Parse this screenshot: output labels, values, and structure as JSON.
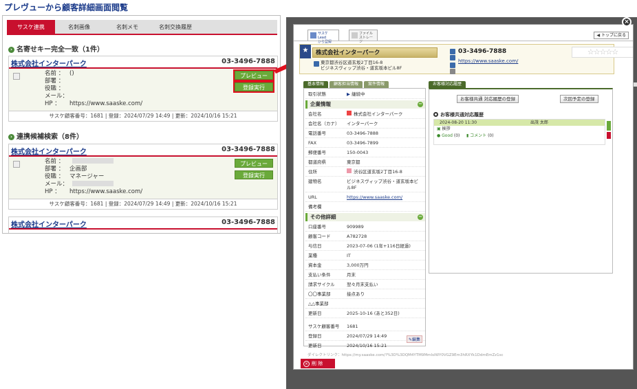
{
  "page_title": "プレヴューから顧客詳細画面閲覧",
  "left": {
    "tabs": [
      "サスケ連携",
      "名刺画像",
      "名刺メモ",
      "名刺交換履歴"
    ],
    "section1": "名寄せキー完全一致（1件）",
    "section2": "連携候補検索（8件）",
    "card1": {
      "company": "株式会社インターパーク",
      "tel": "03-3496-7888",
      "labels": [
        "名前 ：",
        "部署 ：",
        "役職 ：",
        "メール：",
        "HP ："
      ],
      "name_val": "()",
      "hp_val": "https://www.saaske.com/",
      "preview": "プレビュー",
      "register": "登録実行",
      "foot": "サスケ顧客番号：1681 | 登録：2024/07/29 14:49 | 更新：2024/10/16 15:21"
    },
    "card2": {
      "company": "株式会社インターパーク",
      "tel": "03-3496-7888",
      "labels": [
        "名前 ：",
        "部署 ：",
        "役職 ：",
        "メール：",
        "HP ："
      ],
      "dept_val": "企画部",
      "role_val": "マネージャー",
      "hp_val": "https://www.saaske.com/",
      "preview": "プレビュー",
      "register": "登録実行",
      "foot": "サスケ顧客番号：1681 | 登録：2024/07/29 14:49 | 更新：2024/10/16 15:21"
    },
    "card3": {
      "company": "株式会社インターパーク",
      "tel": "03-3496-7888"
    }
  },
  "modal": {
    "tab1": "サスケ Lead\nから登録",
    "tab2": "ファイル\nストレージ",
    "top_link": "トップに戻る",
    "company": "株式会社インターパーク",
    "addr1": "東京都渋谷区道玄坂2丁目16-8",
    "addr2": "ビジネスヴィップ渋谷・道玄坂本ビル8F",
    "tel": "03-3496-7888",
    "url": "https://www.saaske.com/",
    "subtabs": [
      "基本情報",
      "顧客担当情報",
      "案件情報"
    ],
    "right_tab": "お客様対応履歴",
    "status_label": "取引状態",
    "status_val": "継続中",
    "sec_company": "企業情報",
    "rows1": [
      {
        "k": "会社名",
        "v": "株式会社インターパーク"
      },
      {
        "k": "会社名（カナ）",
        "v": "インターパーク"
      },
      {
        "k": "電話番号",
        "v": "03-3496-7888"
      },
      {
        "k": "FAX",
        "v": "03-3496-7899"
      },
      {
        "k": "郵便番号",
        "v": "150-0043"
      },
      {
        "k": "都道府県",
        "v": "東京都"
      },
      {
        "k": "住所",
        "v": "渋谷区道玄坂2丁目16-8"
      },
      {
        "k": "建物名",
        "v": "ビジネスヴィップ渋谷・道玄坂本ビル8F"
      },
      {
        "k": "URL",
        "v": "https://www.saaske.com/"
      },
      {
        "k": "備考欄",
        "v": ""
      }
    ],
    "sec_other": "その他詳細",
    "rows2": [
      {
        "k": "口座番号",
        "v": "909989"
      },
      {
        "k": "顧客コード",
        "v": "A782728"
      },
      {
        "k": "与信日",
        "v": "2023-07-06 (1年+116日経過)"
      },
      {
        "k": "業種",
        "v": "IT"
      },
      {
        "k": "資本金",
        "v": "3,000万円"
      },
      {
        "k": "支払い条件",
        "v": "月末"
      },
      {
        "k": "請求サイクル",
        "v": "翌々月末支払い"
      },
      {
        "k": "〇〇事業部",
        "v": "接点あり"
      },
      {
        "k": "△△事業部",
        "v": ""
      },
      {
        "k": "更新日",
        "v": "2025-10-16 (あと352日)"
      }
    ],
    "rows3": [
      {
        "k": "サスケ顧客番号",
        "v": "1681"
      },
      {
        "k": "登録日",
        "v": "2024/07/29 14:49"
      },
      {
        "k": "更新日",
        "v": "2024/10/16 15:21"
      }
    ],
    "edit": "編集",
    "btn_history": "お客様共通 対応履歴の登録",
    "btn_schedule": "次回予定の登録",
    "hist_title": "お客様共通対応履歴",
    "hist_date": "2024-08-20 11:30",
    "hist_user": "出茂 太郎",
    "hist_msg": "挨拶",
    "hist_good": "Good",
    "hist_good_count": "(0)",
    "hist_comment": "コメント",
    "hist_comment_count": "(0)",
    "direct_link": "ダイレクトリンク：https://my.saaske.com/?%3D%3DQM4YTM9MmIsIWY0VGZ9Em3hRXYk1DdmEmZz1sc",
    "delete": "削 除"
  },
  "colors": {
    "accent_red": "#c8102e",
    "green": "#6aaa3a",
    "navy": "#1a3a8a"
  }
}
